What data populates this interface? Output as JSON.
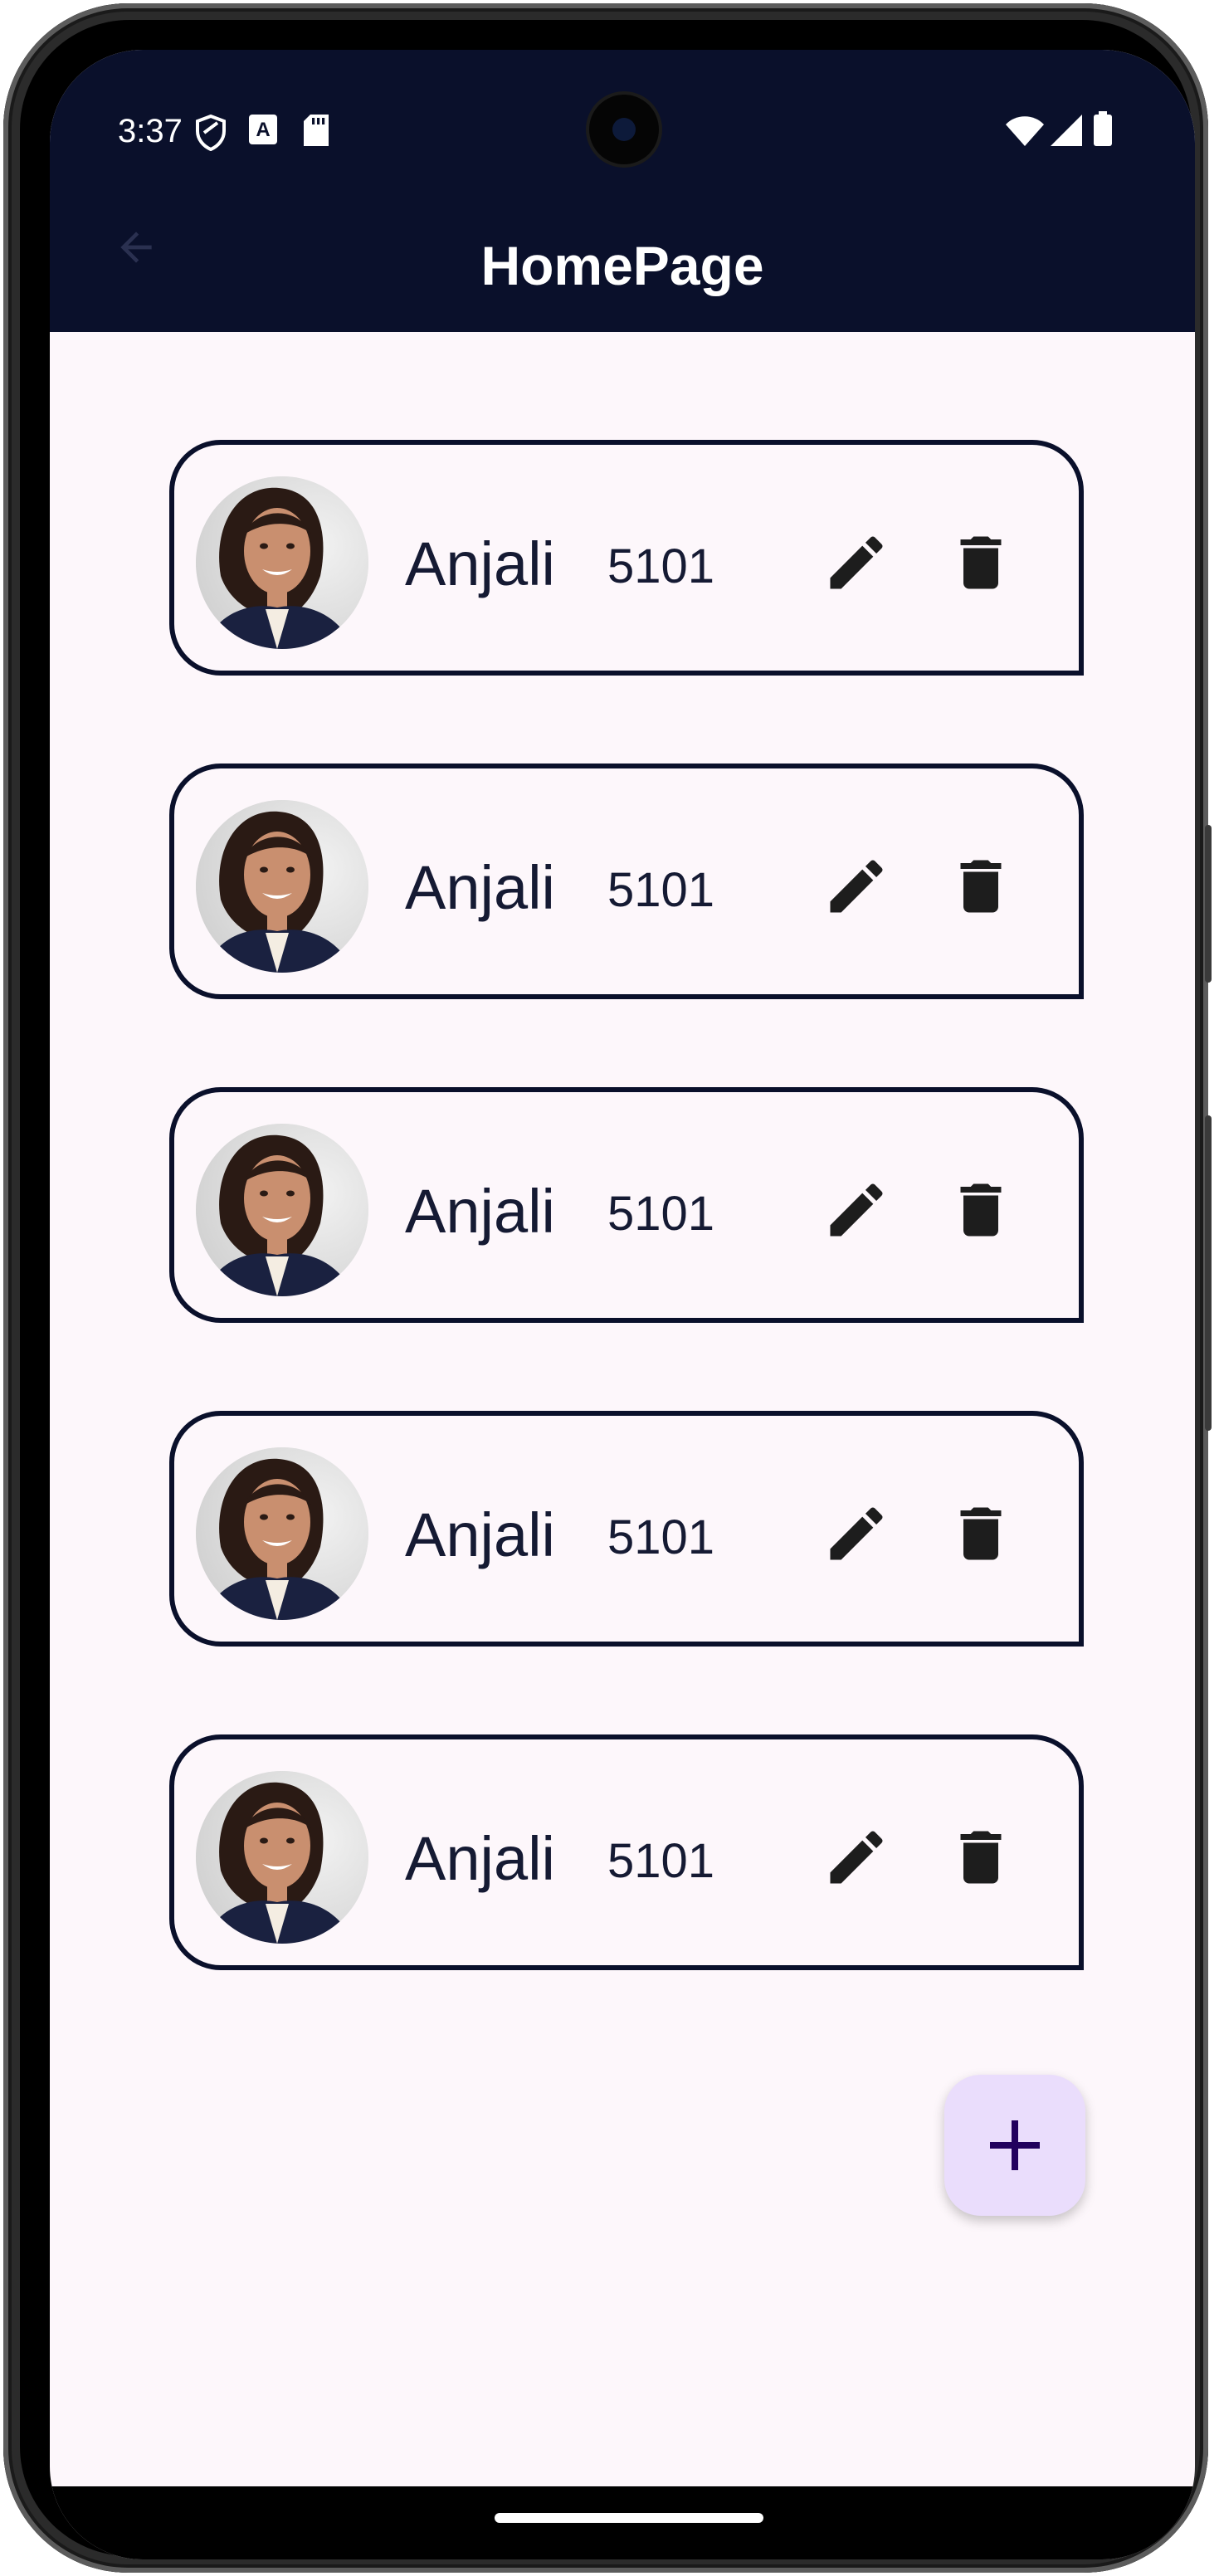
{
  "status_bar": {
    "time": "3:37",
    "icons_left": [
      "shield-icon",
      "text-a-icon",
      "sd-card-icon"
    ],
    "icons_right": [
      "wifi-icon",
      "cell-signal-icon",
      "battery-icon"
    ]
  },
  "app_bar": {
    "title": "HomePage",
    "back_icon": "arrow-back-icon"
  },
  "colors": {
    "app_bar": "#0a102b",
    "background": "#fdf7fb",
    "card_border": "#0a102b",
    "fab": "#eaddfc",
    "fab_icon": "#21005d"
  },
  "cards": [
    {
      "name": "Anjali",
      "number": "5101"
    },
    {
      "name": "Anjali",
      "number": "5101"
    },
    {
      "name": "Anjali",
      "number": "5101"
    },
    {
      "name": "Anjali",
      "number": "5101"
    },
    {
      "name": "Anjali",
      "number": "5101"
    }
  ],
  "card_icons": {
    "edit": "pencil-icon",
    "delete": "trash-icon"
  },
  "fab": {
    "icon": "plus-icon"
  }
}
